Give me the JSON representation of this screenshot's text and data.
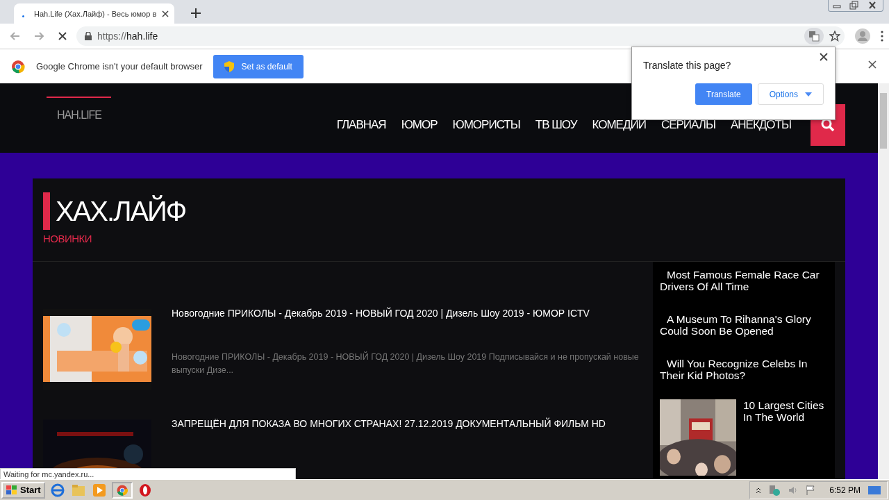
{
  "browser": {
    "tab": {
      "title": "Hah.Life (Хах.Лайф) - Весь юмор в"
    },
    "url_scheme": "https://",
    "url_host": "hah.life"
  },
  "infobar": {
    "text": "Google Chrome isn't your default browser",
    "button": "Set as default"
  },
  "translate_popup": {
    "title": "Translate this page?",
    "buttons": [
      "Translate",
      "Options"
    ]
  },
  "site": {
    "logo": "HAH.LIFE",
    "nav": [
      "ГЛАВНАЯ",
      "ЮМОР",
      "ЮМОРИСТЫ",
      "ТВ ШОУ",
      "КОМЕДИИ",
      "СЕРИАЛЫ",
      "АНЕКДОТЫ"
    ],
    "heading": "ХАХ.ЛАЙФ",
    "subheading": "НОВИНКИ"
  },
  "videos": [
    {
      "title": "Новогодние ПРИКОЛЫ - Декабрь 2019 - НОВЫЙ ГОД 2020 | Дизель Шоу 2019 - ЮМОР ICTV",
      "description": "Новогодние ПРИКОЛЫ - Декабрь 2019 - НОВЫЙ ГОД 2020 | Дизель Шоу 2019 Подписывайся и не пропускай новые выпуски Дизе..."
    },
    {
      "title": "ЗАПРЕЩЁН ДЛЯ ПОКАЗА ВО МНОГИХ СТРАНАХ! 27.12.2019 ДОКУМЕНТАЛЬНЫЙ ФИЛЬМ HD"
    }
  ],
  "sidebar": [
    {
      "kind": "text",
      "title": "Most Famous Female Race Car Drivers Of All Time"
    },
    {
      "kind": "text",
      "title": "A Museum To Rihanna's Glory Could Soon Be Opened"
    },
    {
      "kind": "text",
      "title": "Will You Recognize Celebs In Their Kid Photos?"
    },
    {
      "kind": "picture",
      "title": "10 Largest Cities In The World"
    }
  ],
  "status_bubble": "Waiting for mc.yandex.ru...",
  "taskbar": {
    "start": "Start",
    "clock": "6:52 PM"
  }
}
